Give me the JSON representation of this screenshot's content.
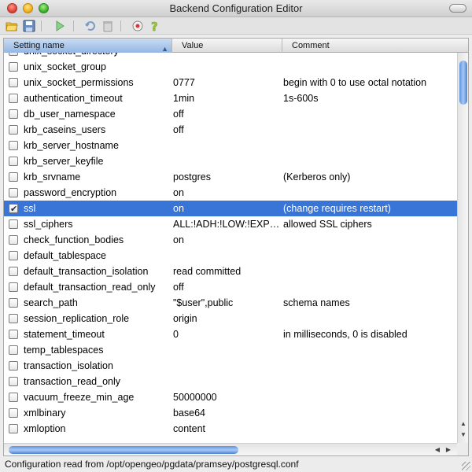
{
  "window": {
    "title": "Backend Configuration Editor"
  },
  "toolbar": {
    "buttons": [
      {
        "name": "open-icon"
      },
      {
        "name": "save-icon"
      },
      {
        "name": "run-icon"
      },
      {
        "name": "undo-icon"
      },
      {
        "name": "delete-icon"
      },
      {
        "name": "help-contents-icon"
      },
      {
        "name": "help-icon"
      }
    ]
  },
  "table": {
    "columns": [
      "Setting name",
      "Value",
      "Comment"
    ],
    "partial_top_row": "unix_socket_directory",
    "rows": [
      {
        "checked": false,
        "name": "unix_socket_group",
        "value": "",
        "comment": ""
      },
      {
        "checked": false,
        "name": "unix_socket_permissions",
        "value": "0777",
        "comment": "begin with 0 to use octal notation"
      },
      {
        "checked": false,
        "name": "authentication_timeout",
        "value": "1min",
        "comment": "1s-600s"
      },
      {
        "checked": false,
        "name": "db_user_namespace",
        "value": "off",
        "comment": ""
      },
      {
        "checked": false,
        "name": "krb_caseins_users",
        "value": "off",
        "comment": ""
      },
      {
        "checked": false,
        "name": "krb_server_hostname",
        "value": "",
        "comment": ""
      },
      {
        "checked": false,
        "name": "krb_server_keyfile",
        "value": "",
        "comment": ""
      },
      {
        "checked": false,
        "name": "krb_srvname",
        "value": "postgres",
        "comment": "(Kerberos only)"
      },
      {
        "checked": false,
        "name": "password_encryption",
        "value": "on",
        "comment": ""
      },
      {
        "checked": true,
        "name": "ssl",
        "value": "on",
        "comment": "(change requires restart)",
        "selected": true
      },
      {
        "checked": false,
        "name": "ssl_ciphers",
        "value": "ALL:!ADH:!LOW:!EXP:...",
        "comment": "allowed SSL ciphers"
      },
      {
        "checked": false,
        "name": "check_function_bodies",
        "value": "on",
        "comment": ""
      },
      {
        "checked": false,
        "name": "default_tablespace",
        "value": "",
        "comment": ""
      },
      {
        "checked": false,
        "name": "default_transaction_isolation",
        "value": "read committed",
        "comment": ""
      },
      {
        "checked": false,
        "name": "default_transaction_read_only",
        "value": "off",
        "comment": ""
      },
      {
        "checked": false,
        "name": "search_path",
        "value": "\"$user\",public",
        "comment": "schema names"
      },
      {
        "checked": false,
        "name": "session_replication_role",
        "value": "origin",
        "comment": ""
      },
      {
        "checked": false,
        "name": "statement_timeout",
        "value": "0",
        "comment": "in milliseconds, 0 is disabled"
      },
      {
        "checked": false,
        "name": "temp_tablespaces",
        "value": "",
        "comment": ""
      },
      {
        "checked": false,
        "name": "transaction_isolation",
        "value": "",
        "comment": ""
      },
      {
        "checked": false,
        "name": "transaction_read_only",
        "value": "",
        "comment": ""
      },
      {
        "checked": false,
        "name": "vacuum_freeze_min_age",
        "value": "50000000",
        "comment": ""
      },
      {
        "checked": false,
        "name": "xmlbinary",
        "value": "base64",
        "comment": ""
      },
      {
        "checked": false,
        "name": "xmloption",
        "value": "content",
        "comment": ""
      }
    ]
  },
  "status": {
    "text": "Configuration read from /opt/opengeo/pgdata/pramsey/postgresql.conf"
  },
  "colors": {
    "selection": "#3875d7",
    "accent": "#4a84d6"
  }
}
